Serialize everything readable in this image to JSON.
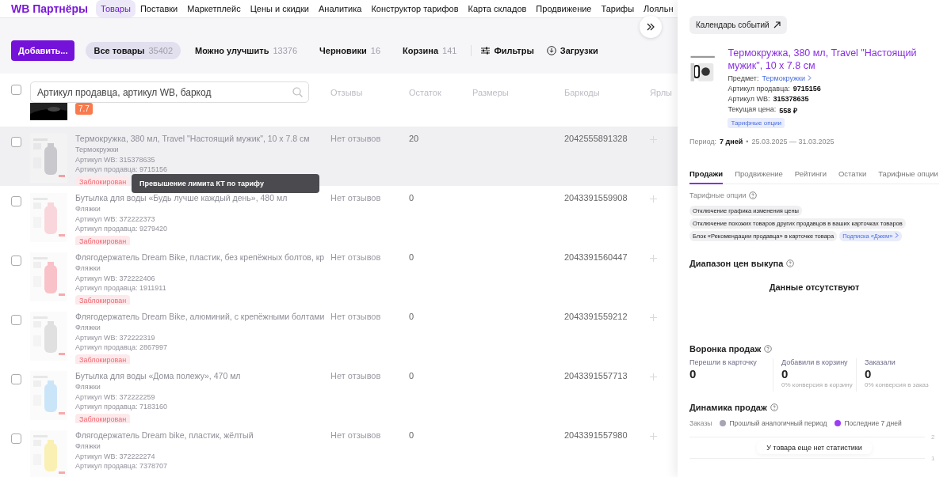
{
  "nav": {
    "brand": "WB Партнёры",
    "items": [
      {
        "label": "Товары",
        "selected": true
      },
      {
        "label": "Поставки",
        "selected": false
      },
      {
        "label": "Маркетплейс",
        "selected": false
      },
      {
        "label": "Цены и скидки",
        "selected": false
      },
      {
        "label": "Аналитика",
        "selected": false
      },
      {
        "label": "Конструктор тарифов",
        "selected": false
      },
      {
        "label": "Карта складов",
        "selected": false
      },
      {
        "label": "Продвижение",
        "selected": false
      },
      {
        "label": "Тарифы",
        "selected": false
      },
      {
        "label": "Лояльн",
        "selected": false
      }
    ]
  },
  "toolbar": {
    "add_button": "Добавить...",
    "filters": [
      {
        "label": "Все товары",
        "count": "35402",
        "selected": true
      },
      {
        "label": "Можно улучшить",
        "count": "13376",
        "selected": false
      },
      {
        "label": "Черновики",
        "count": "16",
        "selected": false
      },
      {
        "label": "Корзина",
        "count": "141",
        "selected": false
      }
    ],
    "filter_button": "Фильтры",
    "downloads_button": "Загрузки"
  },
  "table": {
    "select_all": {
      "checked": false
    },
    "search": {
      "placeholder": "Артикул продавца, артикул WB, баркод"
    },
    "columns": [
      "Отзывы",
      "Остаток",
      "Размеры",
      "Баркоды",
      "Ярлы"
    ],
    "partial_row": {
      "rating": "7.7"
    },
    "tooltip": "Превышение лимита КТ по тарифу",
    "rows": [
      {
        "title": "Термокружка, 380 мл, Travel \"Настоящий мужик\", 10 х 7.8 см",
        "subject": "Термокружки",
        "wb": "Артикул WB: 315378635",
        "seller": "Артикул продавца: 9715156",
        "status": "Заблокирован",
        "reviews": "Нет отзывов",
        "stock": "20",
        "barcode": "2042555891328",
        "checked": false,
        "highlighted": true
      },
      {
        "title": "Бутылка для воды «Будь лучше каждый день», 480 мл",
        "subject": "Фляжки",
        "wb": "Артикул WB: 372222373",
        "seller": "Артикул продавца: 9279420",
        "status": "Заблокирован",
        "reviews": "Нет отзывов",
        "stock": "0",
        "barcode": "2043391559908",
        "checked": false,
        "highlighted": false
      },
      {
        "title": "Флягодержатель Dream Bike, пластик, без крепёжных болтов, кр",
        "subject": "Фляжки",
        "wb": "Артикул WB: 372222406",
        "seller": "Артикул продавца: 1911911",
        "status": "Заблокирован",
        "reviews": "Нет отзывов",
        "stock": "0",
        "barcode": "2043391560447",
        "checked": false,
        "highlighted": false
      },
      {
        "title": "Флягодержатель Dream Bike, алюминий, с крепёжными болтами",
        "subject": "Фляжки",
        "wb": "Артикул WB: 372222319",
        "seller": "Артикул продавца: 2867997",
        "status": "Заблокирован",
        "reviews": "Нет отзывов",
        "stock": "0",
        "barcode": "2043391559212",
        "checked": false,
        "highlighted": false
      },
      {
        "title": "Бутылка для воды «Дома полежу», 470 мл",
        "subject": "Фляжки",
        "wb": "Артикул WB: 372222259",
        "seller": "Артикул продавца: 7183160",
        "status": "Заблокирован",
        "reviews": "Нет отзывов",
        "stock": "0",
        "barcode": "2043391557713",
        "checked": false,
        "highlighted": false
      },
      {
        "title": "Флягодержатель Dream bike, пластик, жёлтый",
        "subject": "Фляжки",
        "wb": "Артикул WB: 372222274",
        "seller": "Артикул продавца: 7378707",
        "reviews": "Нет отзывов",
        "stock": "0",
        "barcode": "2043391557980",
        "checked": false,
        "highlighted": false
      }
    ]
  },
  "drawer": {
    "calendar_button": "Календарь событий",
    "product": {
      "title": "Термокружка, 380 мл, Travel \"Настоящий мужик\", 10 х 7.8 см",
      "fields": [
        {
          "label": "Предмет:",
          "value": "Термокружки",
          "kind": "link"
        },
        {
          "label": "Артикул продавца:",
          "value": "9715156",
          "kind": "text"
        },
        {
          "label": "Артикул WB:",
          "value": "315378635",
          "kind": "text"
        },
        {
          "label": "Текущая цена:",
          "value": "558 ₽",
          "kind": "text"
        }
      ],
      "tag": "Тарифные опции"
    },
    "period": {
      "label": "Период:",
      "value": "7 дней",
      "separator": "•",
      "range": "25.03.2025 — 31.03.2025"
    },
    "tabs": [
      {
        "label": "Продажи",
        "selected": true
      },
      {
        "label": "Продвижение",
        "selected": false
      },
      {
        "label": "Рейтинги",
        "selected": false
      },
      {
        "label": "Остатки",
        "selected": false
      },
      {
        "label": "Тарифные опции",
        "selected": false
      }
    ],
    "tariff": {
      "title": "Тарифные опции",
      "chips": [
        {
          "label": "Отключение графика изменения цены",
          "kind": "option"
        },
        {
          "label": "Отключение похожих товаров других продавцов в ваших карточках товаров",
          "kind": "option"
        },
        {
          "label": "Блок «Рекомендации продавца» в карточке товара",
          "kind": "option"
        },
        {
          "label": "Подписка «Джем»",
          "kind": "link"
        }
      ]
    },
    "price_range": {
      "title": "Диапазон цен выкупа",
      "empty": "Данные отсутствуют"
    },
    "funnel": {
      "title": "Воронка продаж",
      "steps": [
        {
          "label": "Перешли в карточку",
          "value": "0"
        },
        {
          "label": "Добавили в корзину",
          "value": "0",
          "note": "0% конверсия в корзину"
        },
        {
          "label": "Заказали",
          "value": "0",
          "note": "0% конверсия в заказ"
        }
      ]
    },
    "dynamics": {
      "title": "Динамика продаж",
      "metric": "Заказы",
      "legend": [
        {
          "label": "Прошлый аналогичный период",
          "color": "#a8a4b4"
        },
        {
          "label": "Последние 7 дней",
          "color": "#9b3df5"
        }
      ],
      "grid_labels": [
        "2",
        "1"
      ],
      "empty": "У товара еще нет статистики"
    }
  }
}
